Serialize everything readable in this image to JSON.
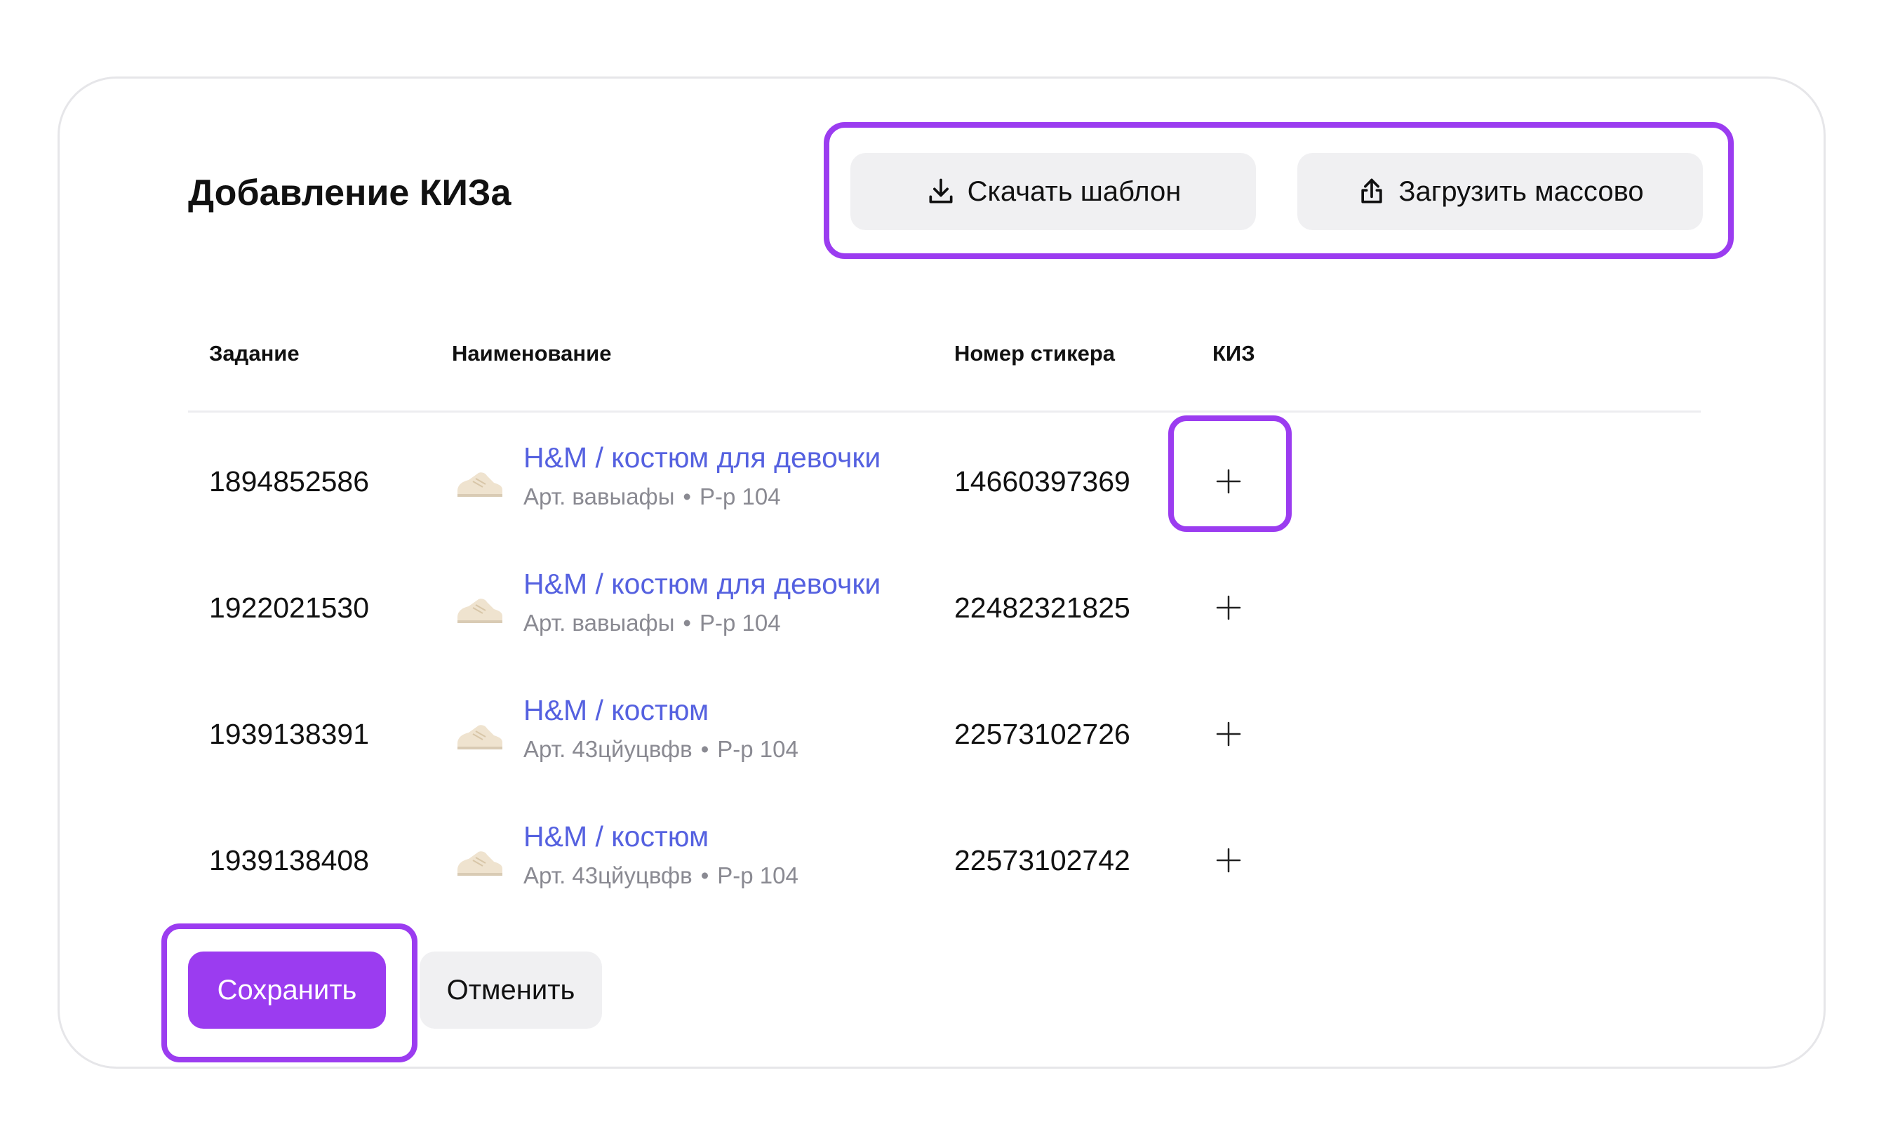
{
  "dialog": {
    "title": "Добавление КИЗа"
  },
  "toolbar": {
    "download_label": "Скачать шаблон",
    "upload_label": "Загрузить массово",
    "download_icon": "download-icon",
    "upload_icon": "upload-icon"
  },
  "table": {
    "headers": {
      "task": "Задание",
      "name": "Наименование",
      "sticker": "Номер стикера",
      "kiz": "КИЗ"
    },
    "rows": [
      {
        "task": "1894852586",
        "product_name": "H&M / костюм для девочки",
        "article": "Арт. вавыафы",
        "size": "Р-р 104",
        "sticker": "14660397369"
      },
      {
        "task": "1922021530",
        "product_name": "H&M / костюм для девочки",
        "article": "Арт. вавыафы",
        "size": "Р-р 104",
        "sticker": "22482321825"
      },
      {
        "task": "1939138391",
        "product_name": "H&M / костюм",
        "article": "Арт. 43цйуцвфв",
        "size": "Р-р 104",
        "sticker": "22573102726"
      },
      {
        "task": "1939138408",
        "product_name": "H&M / костюм",
        "article": "Арт. 43цйуцвфв",
        "size": "Р-р 104",
        "sticker": "22573102742"
      }
    ]
  },
  "actions": {
    "save_label": "Сохранить",
    "cancel_label": "Отменить"
  },
  "colors": {
    "accent": "#9b3cf0",
    "link": "#5561e0",
    "muted_text": "#8a8a92",
    "button_grey": "#f0f0f2",
    "card_border": "#e6e6e9"
  }
}
